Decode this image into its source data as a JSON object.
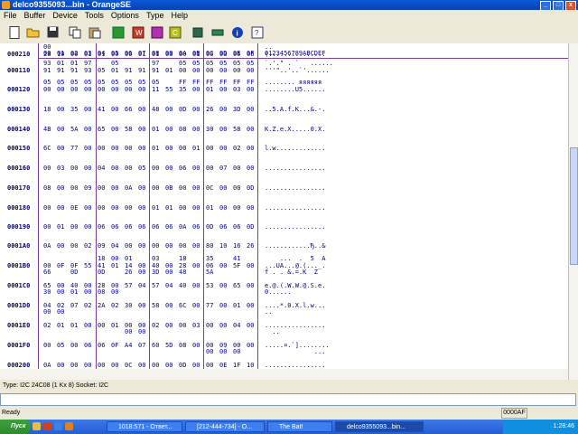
{
  "window": {
    "title": "delco9355093...bin - OrangeSE"
  },
  "menu": [
    "File",
    "Buffer",
    "Device",
    "Tools",
    "Options",
    "Type",
    "Help"
  ],
  "toolbar": {
    "icons": [
      "new-icon",
      "open-icon",
      "save-icon",
      "copy-icon",
      "paste-icon",
      "read-icon",
      "write-icon",
      "erase-icon",
      "verify-icon",
      "device-icon",
      "connect-icon",
      "info-icon",
      "help-icon"
    ]
  },
  "hex": {
    "headers": [
      "00",
      "01",
      "02",
      "03",
      "04",
      "05",
      "06",
      "07",
      "08",
      "09",
      "0A",
      "0B",
      "0C",
      "0D",
      "0E",
      "0F"
    ],
    "ascii_header": "0123456789ABCDEF",
    "rows": [
      {
        "addr": "000110",
        "l1": [
          "93",
          "01",
          "01",
          "97",
          "",
          "05",
          "",
          "",
          "97",
          "",
          "05",
          "05",
          "05",
          "05",
          "05",
          "05"
        ],
        "l2": [
          "91",
          "91",
          "91",
          "93",
          "05",
          "01",
          "91",
          "91",
          "91",
          "01",
          "00",
          "00",
          "00",
          "00",
          "00",
          "00"
        ],
        "l3": [
          "",
          "",
          "",
          "",
          "",
          "",
          "",
          "",
          "",
          "",
          "",
          "",
          "",
          "",
          "",
          ""
        ],
        "a1": "`.'.\" . `   ......",
        "a2": "'''\"..'..`'......",
        "a3": ""
      },
      {
        "addr": "000120",
        "l1": [
          "05",
          "05",
          "05",
          "05",
          "05",
          "05",
          "05",
          "05",
          "05",
          "",
          "FF",
          "FF",
          "FF",
          "FF",
          "FF",
          "FF"
        ],
        "l2": [
          "00",
          "00",
          "00",
          "00",
          "00",
          "00",
          "00",
          "00",
          "11",
          "55",
          "35",
          "00",
          "01",
          "00",
          "03",
          "00"
        ],
        "l3": [
          "",
          "",
          "",
          "",
          "",
          "",
          "",
          "",
          "",
          "",
          "",
          "",
          "",
          "",
          "",
          ""
        ],
        "a1": "........ яяяяяя",
        "a2": "........U5......",
        "a3": ""
      },
      {
        "addr": "000130",
        "l1": [
          "",
          "",
          "",
          "",
          "",
          "",
          "",
          "",
          "",
          "",
          "",
          "",
          "",
          "",
          "",
          ""
        ],
        "l2": [
          "18",
          "00",
          "35",
          "00",
          "41",
          "00",
          "66",
          "00",
          "48",
          "00",
          "0D",
          "00",
          "26",
          "00",
          "3D",
          "00"
        ],
        "l3": [
          "",
          "",
          "",
          "",
          "",
          "",
          "",
          "",
          "",
          "",
          "",
          "",
          "",
          "",
          "",
          ""
        ],
        "a1": "",
        "a2": "..5.A.f.K...&.-.",
        "a3": ""
      },
      {
        "addr": "000140",
        "l1": [
          "",
          "",
          "",
          "",
          "",
          "",
          "",
          "",
          "",
          "",
          "",
          "",
          "",
          "",
          "",
          ""
        ],
        "l2": [
          "4B",
          "00",
          "5A",
          "00",
          "65",
          "00",
          "58",
          "00",
          "01",
          "00",
          "08",
          "00",
          "30",
          "00",
          "58",
          "00"
        ],
        "l3": [
          "",
          "",
          "",
          "",
          "",
          "",
          "",
          "",
          "",
          "",
          "",
          "",
          "",
          "",
          "",
          ""
        ],
        "a1": "",
        "a2": "K.Z.e.X.....0.X.",
        "a3": ""
      },
      {
        "addr": "000150",
        "l1": [
          "",
          "",
          "",
          "",
          "",
          "",
          "",
          "",
          "",
          "",
          "",
          "",
          "",
          "",
          "",
          ""
        ],
        "l2": [
          "6C",
          "00",
          "77",
          "00",
          "00",
          "00",
          "00",
          "00",
          "01",
          "00",
          "00",
          "01",
          "00",
          "00",
          "02",
          "00"
        ],
        "l3": [
          "",
          "",
          "",
          "",
          "",
          "",
          "",
          "",
          "",
          "",
          "",
          "",
          "",
          "",
          "",
          ""
        ],
        "a1": "",
        "a2": "l.w.............",
        "a3": ""
      },
      {
        "addr": "000160",
        "l1": [
          "",
          "",
          "",
          "",
          "",
          "",
          "",
          "",
          "",
          "",
          "",
          "",
          "",
          "",
          "",
          ""
        ],
        "l2": [
          "00",
          "03",
          "00",
          "00",
          "04",
          "00",
          "00",
          "05",
          "00",
          "00",
          "06",
          "00",
          "00",
          "07",
          "00",
          "00"
        ],
        "l3": [
          "",
          "",
          "",
          "",
          "",
          "",
          "",
          "",
          "",
          "",
          "",
          "",
          "",
          "",
          "",
          ""
        ],
        "a1": "",
        "a2": "................",
        "a3": ""
      },
      {
        "addr": "000170",
        "l1": [
          "",
          "",
          "",
          "",
          "",
          "",
          "",
          "",
          "",
          "",
          "",
          "",
          "",
          "",
          "",
          ""
        ],
        "l2": [
          "08",
          "00",
          "00",
          "09",
          "00",
          "00",
          "0A",
          "00",
          "00",
          "0B",
          "00",
          "00",
          "0C",
          "00",
          "00",
          "0D"
        ],
        "l3": [
          "",
          "",
          "",
          "",
          "",
          "",
          "",
          "",
          "",
          "",
          "",
          "",
          "",
          "",
          "",
          ""
        ],
        "a1": "",
        "a2": "................",
        "a3": ""
      },
      {
        "addr": "000180",
        "l1": [
          "",
          "",
          "",
          "",
          "",
          "",
          "",
          "",
          "",
          "",
          "",
          "",
          "",
          "",
          "",
          ""
        ],
        "l2": [
          "00",
          "00",
          "0E",
          "00",
          "00",
          "00",
          "00",
          "00",
          "01",
          "01",
          "00",
          "00",
          "01",
          "00",
          "00",
          "00"
        ],
        "l3": [
          "",
          "",
          "",
          "",
          "",
          "",
          "",
          "",
          "",
          "",
          "",
          "",
          "",
          "",
          "",
          ""
        ],
        "a1": "",
        "a2": "................",
        "a3": ""
      },
      {
        "addr": "000190",
        "l1": [
          "",
          "",
          "",
          "",
          "",
          "",
          "",
          "",
          "",
          "",
          "",
          "",
          "",
          "",
          "",
          ""
        ],
        "l2": [
          "00",
          "01",
          "00",
          "00",
          "06",
          "06",
          "06",
          "06",
          "06",
          "06",
          "0A",
          "06",
          "0D",
          "06",
          "06",
          "0D"
        ],
        "l3": [
          "",
          "",
          "",
          "",
          "",
          "",
          "",
          "",
          "",
          "",
          "",
          "",
          "",
          "",
          "",
          ""
        ],
        "a1": "",
        "a2": "................",
        "a3": ""
      },
      {
        "addr": "0001A0",
        "l1": [
          "",
          "",
          "",
          "",
          "",
          "",
          "",
          "",
          "",
          "",
          "",
          "",
          "",
          "",
          "",
          ""
        ],
        "l2": [
          "0A",
          "00",
          "00",
          "02",
          "09",
          "04",
          "00",
          "00",
          "00",
          "00",
          "00",
          "00",
          "80",
          "10",
          "16",
          "26"
        ],
        "l3": [
          "",
          "",
          "",
          "",
          "",
          "",
          "",
          "",
          "",
          "",
          "",
          "",
          "",
          "",
          "",
          ""
        ],
        "a1": "",
        "a2": "............Ђ..&",
        "a3": ""
      },
      {
        "addr": "0001B0",
        "l1": [
          "",
          "",
          "",
          "",
          "18",
          "00",
          "01",
          "",
          "03",
          "",
          "18",
          "",
          "35",
          "",
          "41",
          ""
        ],
        "l2": [
          "00",
          "0F",
          "0F",
          "55",
          "41",
          "01",
          "14",
          "00",
          "40",
          "00",
          "28",
          "00",
          "06",
          "00",
          "5F",
          "00"
        ],
        "l3": [
          "66",
          "",
          "0D",
          "",
          "0D",
          "",
          "26",
          "00",
          "3D",
          "00",
          "48",
          "",
          "5A",
          "",
          "",
          ""
        ],
        "a1": "    ...  .  5  A",
        "a2": "...UA...@.(..._.",
        "a3": "f . . &.=.K  Z"
      },
      {
        "addr": "0001C0",
        "l1": [
          "",
          "",
          "",
          "",
          "",
          "",
          "",
          "",
          "",
          "",
          "",
          "",
          "",
          "",
          "",
          ""
        ],
        "l2": [
          "65",
          "00",
          "40",
          "00",
          "28",
          "00",
          "57",
          "04",
          "57",
          "04",
          "40",
          "00",
          "53",
          "00",
          "65",
          "00"
        ],
        "l3": [
          "30",
          "00",
          "01",
          "00",
          "08",
          "00",
          "",
          "",
          "",
          "",
          "",
          "",
          "",
          "",
          "",
          ""
        ],
        "a1": "",
        "a2": "e.@.(.W.W.@.S.e.",
        "a3": "0......"
      },
      {
        "addr": "0001D0",
        "l1": [
          "",
          "",
          "",
          "",
          "",
          "",
          "",
          "",
          "",
          "",
          "",
          "",
          "",
          "",
          "",
          ""
        ],
        "l2": [
          "04",
          "02",
          "07",
          "02",
          "2A",
          "02",
          "30",
          "00",
          "58",
          "00",
          "6C",
          "00",
          "77",
          "00",
          "01",
          "00"
        ],
        "l3": [
          "00",
          "00",
          "",
          "",
          "",
          "",
          "",
          "",
          "",
          "",
          "",
          "",
          "",
          "",
          "",
          ""
        ],
        "a1": "",
        "a2": "....*.0.X.l.w...",
        "a3": ".."
      },
      {
        "addr": "0001E0",
        "l1": [
          "",
          "",
          "",
          "",
          "",
          "",
          "",
          "",
          "",
          "",
          "",
          "",
          "",
          "",
          "",
          ""
        ],
        "l2": [
          "02",
          "01",
          "01",
          "00",
          "00",
          "01",
          "00",
          "00",
          "02",
          "00",
          "00",
          "03",
          "00",
          "00",
          "04",
          "00"
        ],
        "l3": [
          "",
          "",
          "",
          "",
          "",
          "",
          "00",
          "00",
          "",
          "",
          "",
          "",
          "",
          "",
          "",
          ""
        ],
        "a1": "",
        "a2": "................",
        "a3": "  .."
      },
      {
        "addr": "0001F0",
        "l1": [
          "",
          "",
          "",
          "",
          "",
          "",
          "",
          "",
          "",
          "",
          "",
          "",
          "",
          "",
          "",
          ""
        ],
        "l2": [
          "00",
          "05",
          "00",
          "06",
          "06",
          "0F",
          "A4",
          "07",
          "60",
          "5D",
          "08",
          "00",
          "00",
          "09",
          "00",
          "00"
        ],
        "l3": [
          "",
          "",
          "",
          "",
          "",
          "",
          "",
          "",
          "",
          "",
          "",
          "",
          "00",
          "00",
          "00",
          ""
        ],
        "a1": "",
        "a2": ".....¤.`]........",
        "a3": "             ..."
      },
      {
        "addr": "000200",
        "l1": [
          "",
          "",
          "",
          "",
          "",
          "",
          "",
          "",
          "",
          "",
          "",
          "",
          "",
          "",
          "",
          ""
        ],
        "l2": [
          "0A",
          "00",
          "00",
          "00",
          "00",
          "00",
          "0C",
          "00",
          "00",
          "00",
          "0D",
          "00",
          "00",
          "0E",
          "1F",
          "10"
        ],
        "l3": [
          "",
          "",
          "",
          "",
          "",
          "",
          "",
          "",
          "",
          "",
          "",
          "",
          "",
          "",
          "",
          ""
        ],
        "a1": "",
        "a2": "................",
        "a3": ""
      },
      {
        "addr": "000210",
        "l1": [
          "00",
          "",
          "",
          "",
          "",
          "",
          "",
          "",
          "",
          "",
          "",
          "",
          "",
          "",
          "",
          ""
        ],
        "l2": [
          "28",
          "10",
          "00",
          "01",
          "01",
          "00",
          "00",
          "01",
          "01",
          "00",
          "00",
          "01",
          "00",
          "00",
          "06",
          "06"
        ],
        "l3": [
          "",
          "",
          "",
          "",
          "",
          "",
          "",
          "",
          "",
          "",
          "",
          "",
          "",
          "",
          "",
          ""
        ],
        "a1": "..",
        "a2": "(...............",
        "a3": ""
      }
    ]
  },
  "status": {
    "type_info": "Type: I2C 24C08 (1 Kx 8)  Socket: I2C",
    "ready": "Ready",
    "offset": "0000AF"
  },
  "taskbar": {
    "start": "Пуск",
    "tasks": [
      "1018:571 - Ответ...",
      "[212-444-734] - O...",
      "The Bat!",
      "delco9355093...bin..."
    ],
    "clock": "1:28:46"
  }
}
